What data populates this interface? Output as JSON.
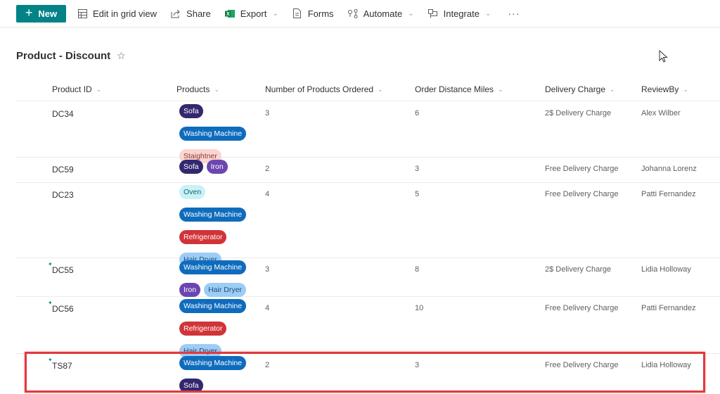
{
  "toolbar": {
    "new_label": "New",
    "items": [
      {
        "label": "Edit in grid view",
        "icon": "grid-icon",
        "has_dropdown": false
      },
      {
        "label": "Share",
        "icon": "share-icon",
        "has_dropdown": false
      },
      {
        "label": "Export",
        "icon": "excel-icon",
        "has_dropdown": true
      },
      {
        "label": "Forms",
        "icon": "forms-icon",
        "has_dropdown": false
      },
      {
        "label": "Automate",
        "icon": "automate-icon",
        "has_dropdown": true
      },
      {
        "label": "Integrate",
        "icon": "integrate-icon",
        "has_dropdown": true
      }
    ],
    "more_label": "···"
  },
  "list": {
    "title": "Product - Discount",
    "favorite_icon": "star-outline-icon"
  },
  "columns": [
    {
      "label": "Product ID"
    },
    {
      "label": "Products"
    },
    {
      "label": "Number of Products Ordered"
    },
    {
      "label": "Order Distance Miles"
    },
    {
      "label": "Delivery Charge"
    },
    {
      "label": "ReviewBy"
    }
  ],
  "chip_colors": {
    "Sofa": {
      "bg": "#32286f",
      "fg": "#ffffff"
    },
    "Washing Machine": {
      "bg": "#0f6cbd",
      "fg": "#ffffff"
    },
    "Staightner": {
      "bg": "#fbd5d0",
      "fg": "#8a3b2e"
    },
    "Iron": {
      "bg": "#6b46b0",
      "fg": "#ffffff"
    },
    "Oven": {
      "bg": "#c7f2f7",
      "fg": "#1f5f6b"
    },
    "Refrigerator": {
      "bg": "#d13438",
      "fg": "#ffffff"
    },
    "Hair Dryer": {
      "bg": "#9ccdf6",
      "fg": "#1b4f7a"
    }
  },
  "rows": [
    {
      "id": "DC34",
      "is_new": false,
      "products": [
        "Sofa",
        "Washing Machine",
        "Staightner"
      ],
      "num_ordered": "3",
      "distance": "6",
      "delivery": "2$ Delivery Charge",
      "review_by": "Alex Wilber"
    },
    {
      "id": "DC59",
      "is_new": false,
      "products": [
        "Sofa",
        "Iron"
      ],
      "num_ordered": "2",
      "distance": "3",
      "delivery": "Free Delivery Charge",
      "review_by": "Johanna Lorenz"
    },
    {
      "id": "DC23",
      "is_new": false,
      "products": [
        "Oven",
        "Washing Machine",
        "Refrigerator",
        "Hair Dryer"
      ],
      "num_ordered": "4",
      "distance": "5",
      "delivery": "Free Delivery Charge",
      "review_by": "Patti Fernandez"
    },
    {
      "id": "DC55",
      "is_new": true,
      "products": [
        "Washing Machine",
        "Iron",
        "Hair Dryer"
      ],
      "num_ordered": "3",
      "distance": "8",
      "delivery": "2$ Delivery Charge",
      "review_by": "Lidia Holloway"
    },
    {
      "id": "DC56",
      "is_new": true,
      "products": [
        "Washing Machine",
        "Refrigerator",
        "Hair Dryer"
      ],
      "num_ordered": "4",
      "distance": "10",
      "delivery": "Free Delivery Charge",
      "review_by": "Patti Fernandez"
    },
    {
      "id": "TS87",
      "is_new": true,
      "products": [
        "Washing Machine",
        "Sofa"
      ],
      "num_ordered": "2",
      "distance": "3",
      "delivery": "Free Delivery Charge",
      "review_by": "Lidia Holloway"
    }
  ],
  "highlighted_row": "TS87",
  "colors": {
    "accent": "#038387",
    "highlight_border": "#e03a3e"
  }
}
